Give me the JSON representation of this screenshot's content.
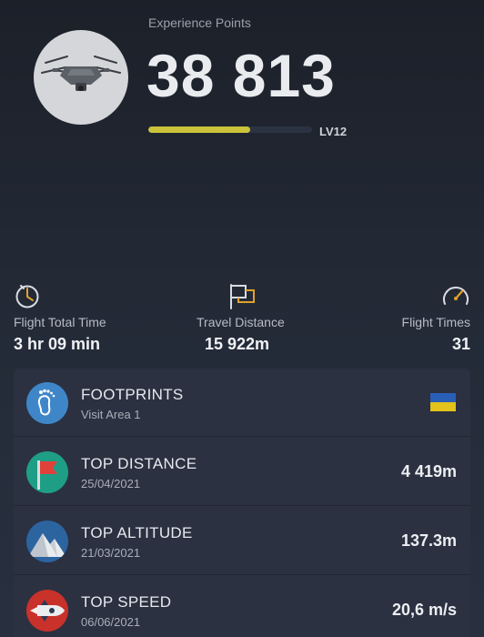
{
  "header": {
    "xp_label": "Experience Points",
    "xp_value": "38 813",
    "level": "LV12",
    "progress": 0.62,
    "avatar_icon": "drone-icon"
  },
  "stats": [
    {
      "icon": "stopwatch-icon",
      "label": "Flight Total Time",
      "value": "3 hr 09 min"
    },
    {
      "icon": "flag-outline-icon",
      "label": "Travel Distance",
      "value": "15 922m"
    },
    {
      "icon": "speedometer-icon",
      "label": "Flight Times",
      "value": "31"
    }
  ],
  "records": [
    {
      "icon": "footprint-icon",
      "title": "FOOTPRINTS",
      "subtitle": "Visit Area 1",
      "value": "",
      "flag_colors": [
        "#2a5fb8",
        "#e2c21b"
      ]
    },
    {
      "icon": "red-flag-icon",
      "title": "TOP DISTANCE",
      "subtitle": "25/04/2021",
      "value": "4 419m"
    },
    {
      "icon": "mountain-icon",
      "title": "TOP ALTITUDE",
      "subtitle": "21/03/2021",
      "value": "137.3m"
    },
    {
      "icon": "rocket-icon",
      "title": "TOP SPEED",
      "subtitle": "06/06/2021",
      "value": "20,6 m/s"
    }
  ],
  "colors": {
    "accent_yellow": "#cbc43b",
    "footprints_badge": "#3f86c8",
    "distance_badge": "#1f9e86",
    "altitude_badge": "#2c64a0",
    "speed_badge": "#c9312b"
  }
}
